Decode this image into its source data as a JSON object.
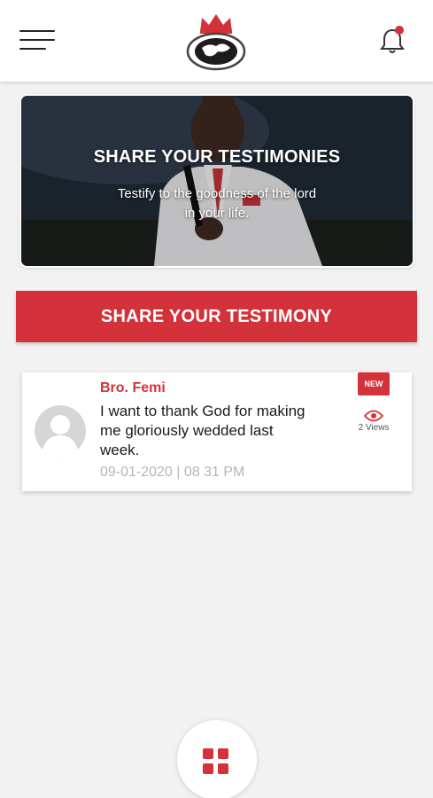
{
  "header": {
    "menu_icon": "hamburger-menu-icon",
    "logo": "church-crest-logo",
    "bell_icon": "notification-bell-icon"
  },
  "banner": {
    "title": "SHARE YOUR TESTIMONIES",
    "subtitle_line1": "Testify to the goodness of the lord",
    "subtitle_line2": "in your life."
  },
  "share_button": {
    "label": "SHARE YOUR TESTIMONY"
  },
  "testimonies": [
    {
      "author": "Bro. Femi",
      "message_lines": [
        "I want to thank God for making",
        "me gloriously wedded last",
        "week."
      ],
      "timestamp": "09-01-2020 | 08 31 PM",
      "badge": "NEW",
      "views": "2 Views"
    }
  ],
  "colors": {
    "accent": "#d3323a",
    "background": "#f2f2f2",
    "card": "#ffffff"
  },
  "fab": {
    "icon": "grid-menu-icon"
  }
}
